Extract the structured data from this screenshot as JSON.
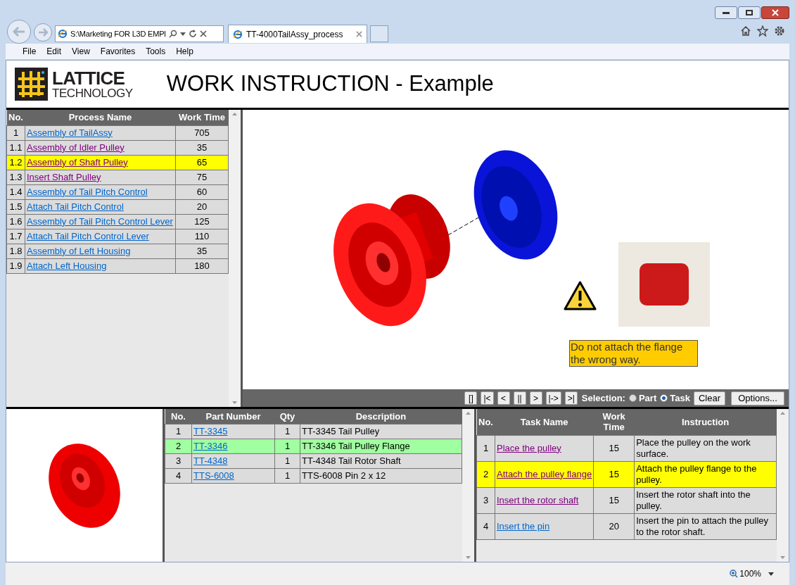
{
  "browser": {
    "address": "S:\\Marketing FOR L3D EMPl",
    "tabs": [
      {
        "label": "TT-4000TailAssy_process",
        "selected": true
      }
    ],
    "menu": [
      "File",
      "Edit",
      "View",
      "Favorites",
      "Tools",
      "Help"
    ],
    "zoom": "100%"
  },
  "header": {
    "logo_line1": "LATTICE",
    "logo_line2": "TECHNOLOGY",
    "title": "WORK INSTRUCTION - Example"
  },
  "processes": {
    "columns": [
      "No.",
      "Process Name",
      "Work Time"
    ],
    "rows": [
      {
        "no": "1",
        "name": "Assembly of TailAssy",
        "time": "705",
        "visited": false,
        "selected": false
      },
      {
        "no": "1.1",
        "name": "Assembly of Idler Pulley",
        "time": "35",
        "visited": true,
        "selected": false
      },
      {
        "no": "1.2",
        "name": "Assembly of Shaft Pulley",
        "time": "65",
        "visited": true,
        "selected": true
      },
      {
        "no": "1.3",
        "name": "Insert Shaft Pulley",
        "time": "75",
        "visited": true,
        "selected": false
      },
      {
        "no": "1.4",
        "name": "Assembly of Tail Pitch Control",
        "time": "60",
        "visited": false,
        "selected": false
      },
      {
        "no": "1.5",
        "name": "Attach Tail Pitch Control",
        "time": "20",
        "visited": false,
        "selected": false
      },
      {
        "no": "1.6",
        "name": "Assembly of Tail Pitch Control Lever",
        "time": "125",
        "visited": false,
        "selected": false
      },
      {
        "no": "1.7",
        "name": "Attach Tail Pitch Control Lever",
        "time": "110",
        "visited": false,
        "selected": false
      },
      {
        "no": "1.8",
        "name": "Assembly of Left Housing",
        "time": "35",
        "visited": false,
        "selected": false
      },
      {
        "no": "1.9",
        "name": "Attach Left Housing",
        "time": "180",
        "visited": false,
        "selected": false
      }
    ]
  },
  "viewer": {
    "note": "Do not attach the flange the wrong way."
  },
  "toolbar": {
    "buttons": [
      "[]",
      "|<",
      "<",
      "||",
      ">",
      "|->",
      ">|"
    ],
    "selection_label": "Selection:",
    "options": [
      {
        "label": "Part",
        "selected": false
      },
      {
        "label": "Task",
        "selected": true
      }
    ],
    "clear": "Clear",
    "options_button": "Options..."
  },
  "parts": {
    "columns": [
      "No.",
      "Part Number",
      "Qty",
      "Description"
    ],
    "rows": [
      {
        "no": "1",
        "part_number": "TT-3345",
        "qty": "1",
        "description": "TT-3345 Tail Pulley",
        "selected": false
      },
      {
        "no": "2",
        "part_number": "TT-3346",
        "qty": "1",
        "description": "TT-3346 Tail Pulley Flange",
        "selected": true
      },
      {
        "no": "3",
        "part_number": "TT-4348",
        "qty": "1",
        "description": "TT-4348 Tail Rotor Shaft",
        "selected": false
      },
      {
        "no": "4",
        "part_number": "TTS-6008",
        "qty": "1",
        "description": "TTS-6008 Pin 2 x 12",
        "selected": false
      }
    ]
  },
  "tasks": {
    "columns": [
      "No.",
      "Task Name",
      "Work Time",
      "Instruction"
    ],
    "rows": [
      {
        "no": "1",
        "name": "Place the pulley",
        "time": "15",
        "instruction": "Place the pulley on the work surface.",
        "visited": true,
        "selected": false
      },
      {
        "no": "2",
        "name": "Attach the pulley flange",
        "time": "15",
        "instruction": "Attach the pulley flange to the pulley.",
        "visited": true,
        "selected": true
      },
      {
        "no": "3",
        "name": "Insert the rotor shaft",
        "time": "15",
        "instruction": "Insert the rotor shaft into the pulley.",
        "visited": true,
        "selected": false
      },
      {
        "no": "4",
        "name": "Insert the pin",
        "time": "20",
        "instruction": "Insert the pin to attach the pulley to the rotor shaft.",
        "visited": false,
        "selected": false
      }
    ]
  }
}
